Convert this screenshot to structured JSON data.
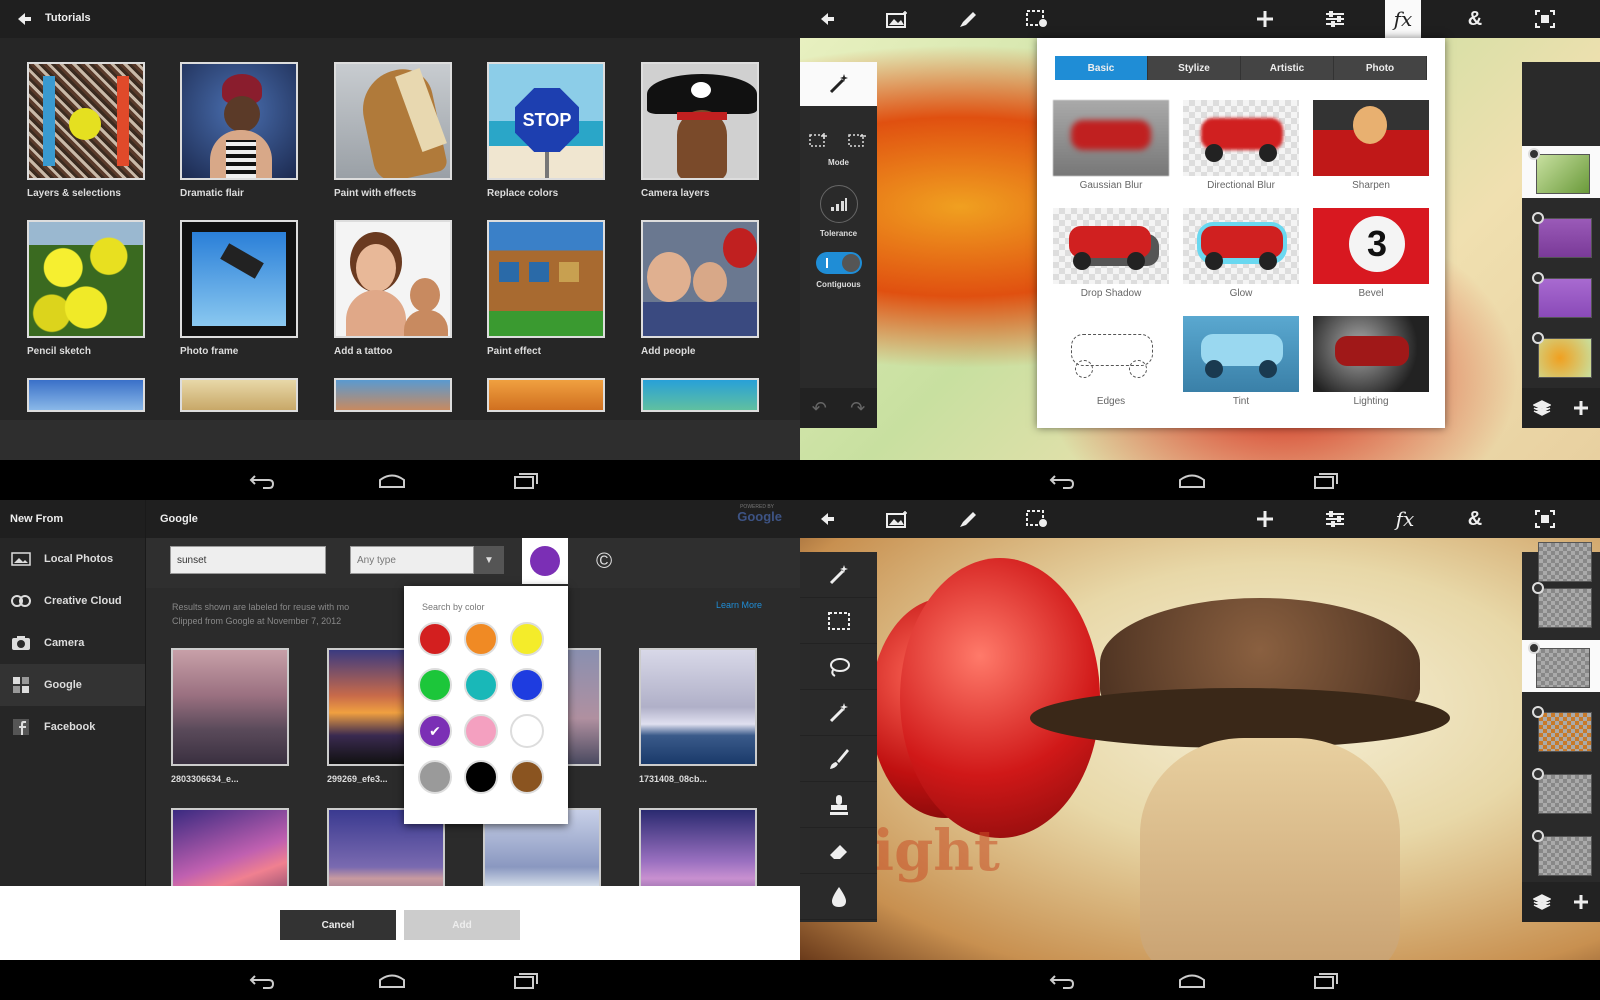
{
  "nav": {
    "back": "back-nav",
    "home": "home-nav",
    "recents": "recents-nav"
  },
  "tutorials": {
    "title": "Tutorials",
    "items": [
      {
        "label": "Layers & selections"
      },
      {
        "label": "Dramatic flair"
      },
      {
        "label": "Paint with effects"
      },
      {
        "label": "Replace colors"
      },
      {
        "label": "Camera layers"
      },
      {
        "label": "Pencil sketch"
      },
      {
        "label": "Photo frame"
      },
      {
        "label": "Add a tattoo"
      },
      {
        "label": "Paint effect"
      },
      {
        "label": "Add people"
      }
    ],
    "stop_sign": "STOP"
  },
  "effects_editor": {
    "toolbar_icons": [
      "back-icon",
      "image-icon",
      "brush-icon",
      "selection-icon",
      "plus-icon",
      "adjust-icon",
      "fx-icon",
      "ampersand-icon",
      "fit-icon"
    ],
    "fx_label": "fx",
    "amp_label": "&",
    "side": {
      "mode": "Mode",
      "tolerance": "Tolerance",
      "contiguous": "Contiguous"
    },
    "tabs": [
      "Basic",
      "Stylize",
      "Artistic",
      "Photo"
    ],
    "active_tab": "Basic",
    "effects": [
      "Gaussian Blur",
      "Directional Blur",
      "Sharpen",
      "Drop Shadow",
      "Glow",
      "Bevel",
      "Edges",
      "Tint",
      "Lighting"
    ],
    "bevel_number": "3"
  },
  "new_from": {
    "title": "New From",
    "sources": [
      {
        "label": "Local Photos",
        "icon": "image-icon"
      },
      {
        "label": "Creative Cloud",
        "icon": "cloud-icon"
      },
      {
        "label": "Camera",
        "icon": "camera-icon"
      },
      {
        "label": "Google",
        "icon": "google-icon"
      },
      {
        "label": "Facebook",
        "icon": "facebook-icon"
      }
    ],
    "active_source": "Google",
    "panel_title": "Google",
    "powered_by": "POWERED BY",
    "google_logo": "Google",
    "search_value": "sunset",
    "type_select": "Any type",
    "selected_color": "#7b2fb5",
    "copyright_symbol": "©",
    "note_line1": "Results shown are labeled for reuse with mo",
    "note_line2": "Clipped from Google at November 7, 2012",
    "learn_more": "Learn More",
    "color_popup_title": "Search by color",
    "colors": [
      "#d31f1f",
      "#f08a24",
      "#f4ec2a",
      "#1cc63a",
      "#19b8b8",
      "#1e3ce0",
      "#7b2fb5",
      "#f4a0c0",
      "#ffffff",
      "#9a9a9a",
      "#000000",
      "#8a5420"
    ],
    "results": [
      {
        "label": "2803306634_e..."
      },
      {
        "label": "299269_efe3..."
      },
      {
        "label": ""
      },
      {
        "label": "1731408_08cb..."
      }
    ],
    "cancel": "Cancel",
    "add": "Add"
  },
  "composite_editor": {
    "tools": [
      "magic-wand-icon",
      "rect-select-icon",
      "lasso-icon",
      "wand-icon",
      "brush-icon",
      "stamp-icon",
      "eraser-icon",
      "drop-icon"
    ],
    "canvas_text": "slight"
  }
}
